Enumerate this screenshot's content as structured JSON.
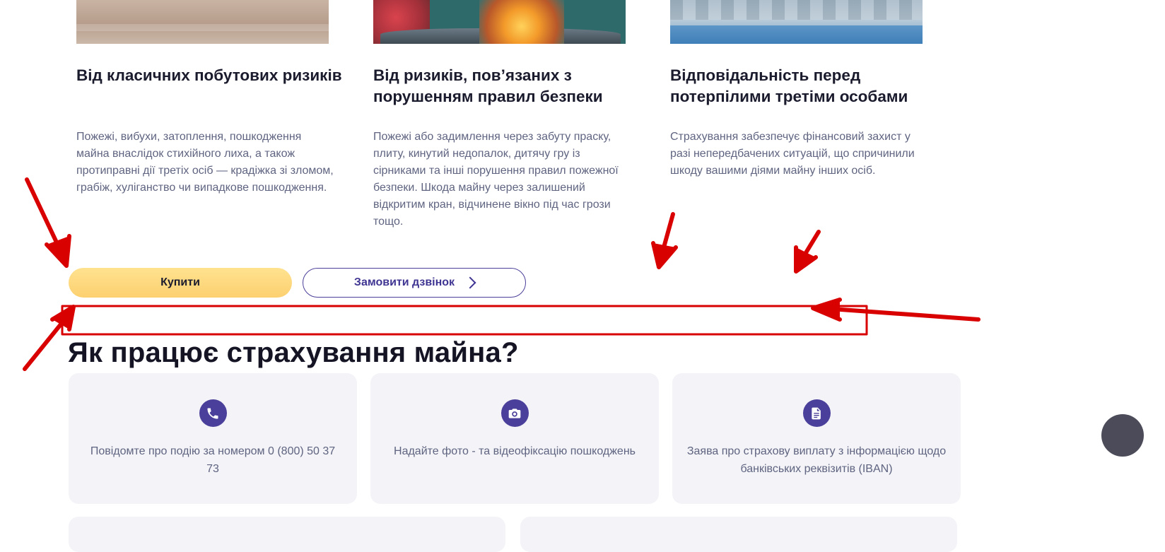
{
  "cards": [
    {
      "title": "Від класичних побутових ризиків",
      "text": "Пожежі, вибухи, затоплення, пошкодження майна внаслідок стихійного лиха, а також протиправні дії третіх осіб — крадіжка зі зломом, грабіж, хуліганство чи випадкове пошкодження."
    },
    {
      "title": "Від ризиків, пов’язаних з порушенням правил безпеки",
      "text": "Пожежі або задимлення через забуту праску, плиту, кинутий недопалок, дитячу гру із сірниками та інші порушення правил пожежної безпеки. Шкода майну через залишений відкритим кран, відчинене вікно під час грози тощо."
    },
    {
      "title": "Відповідальність перед потерпілими третіми особами",
      "text": "Страхування забезпечує фінансовий захист у разі непередбачених ситуацій, що спричинили шкоду вашими діями майну інших осіб."
    }
  ],
  "buttons": {
    "buy_label": "Купити",
    "call_label": "Замовити дзвінок"
  },
  "how_it_works": {
    "title": "Як працює страхування майна?",
    "steps": [
      {
        "icon": "phone-icon",
        "text": "Повідомте про подію за номером 0 (800) 50 37 73"
      },
      {
        "icon": "camera-icon",
        "text": "Надайте фото - та відеофіксацію пошкоджень"
      },
      {
        "icon": "document-icon",
        "text": "Заява про страхову виплату з інформацією щодо банківських реквізитів (IBAN)"
      }
    ]
  },
  "colors": {
    "accent_purple": "#4a3f9a",
    "buy_yellow": "#fcd070",
    "annotation_red": "#d90000"
  }
}
